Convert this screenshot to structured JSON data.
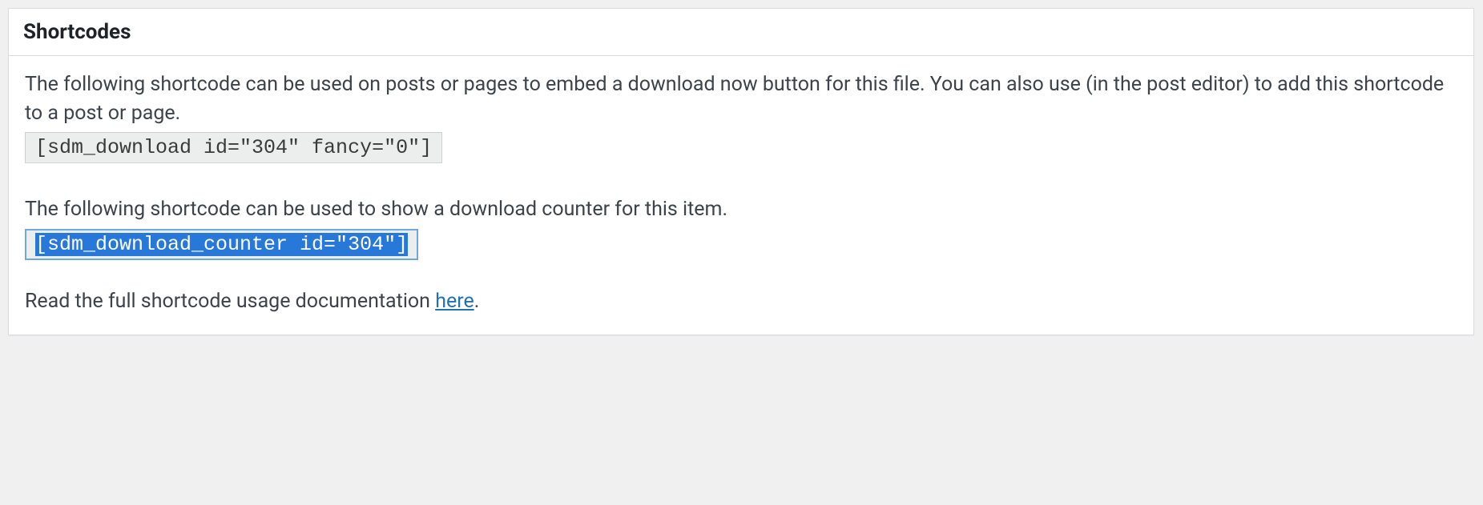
{
  "panel": {
    "title": "Shortcodes"
  },
  "desc1": "The following shortcode can be used on posts or pages to embed a download now button for this file. You can also use (in the post editor) to add this shortcode to a post or page.",
  "shortcode1": "[sdm_download id=\"304\" fancy=\"0\"]",
  "desc2": "The following shortcode can be used to show a download counter for this item.",
  "shortcode2": "[sdm_download_counter id=\"304\"]",
  "doc_text_prefix": "Read the full shortcode usage documentation ",
  "doc_link_text": "here",
  "doc_text_suffix": "."
}
